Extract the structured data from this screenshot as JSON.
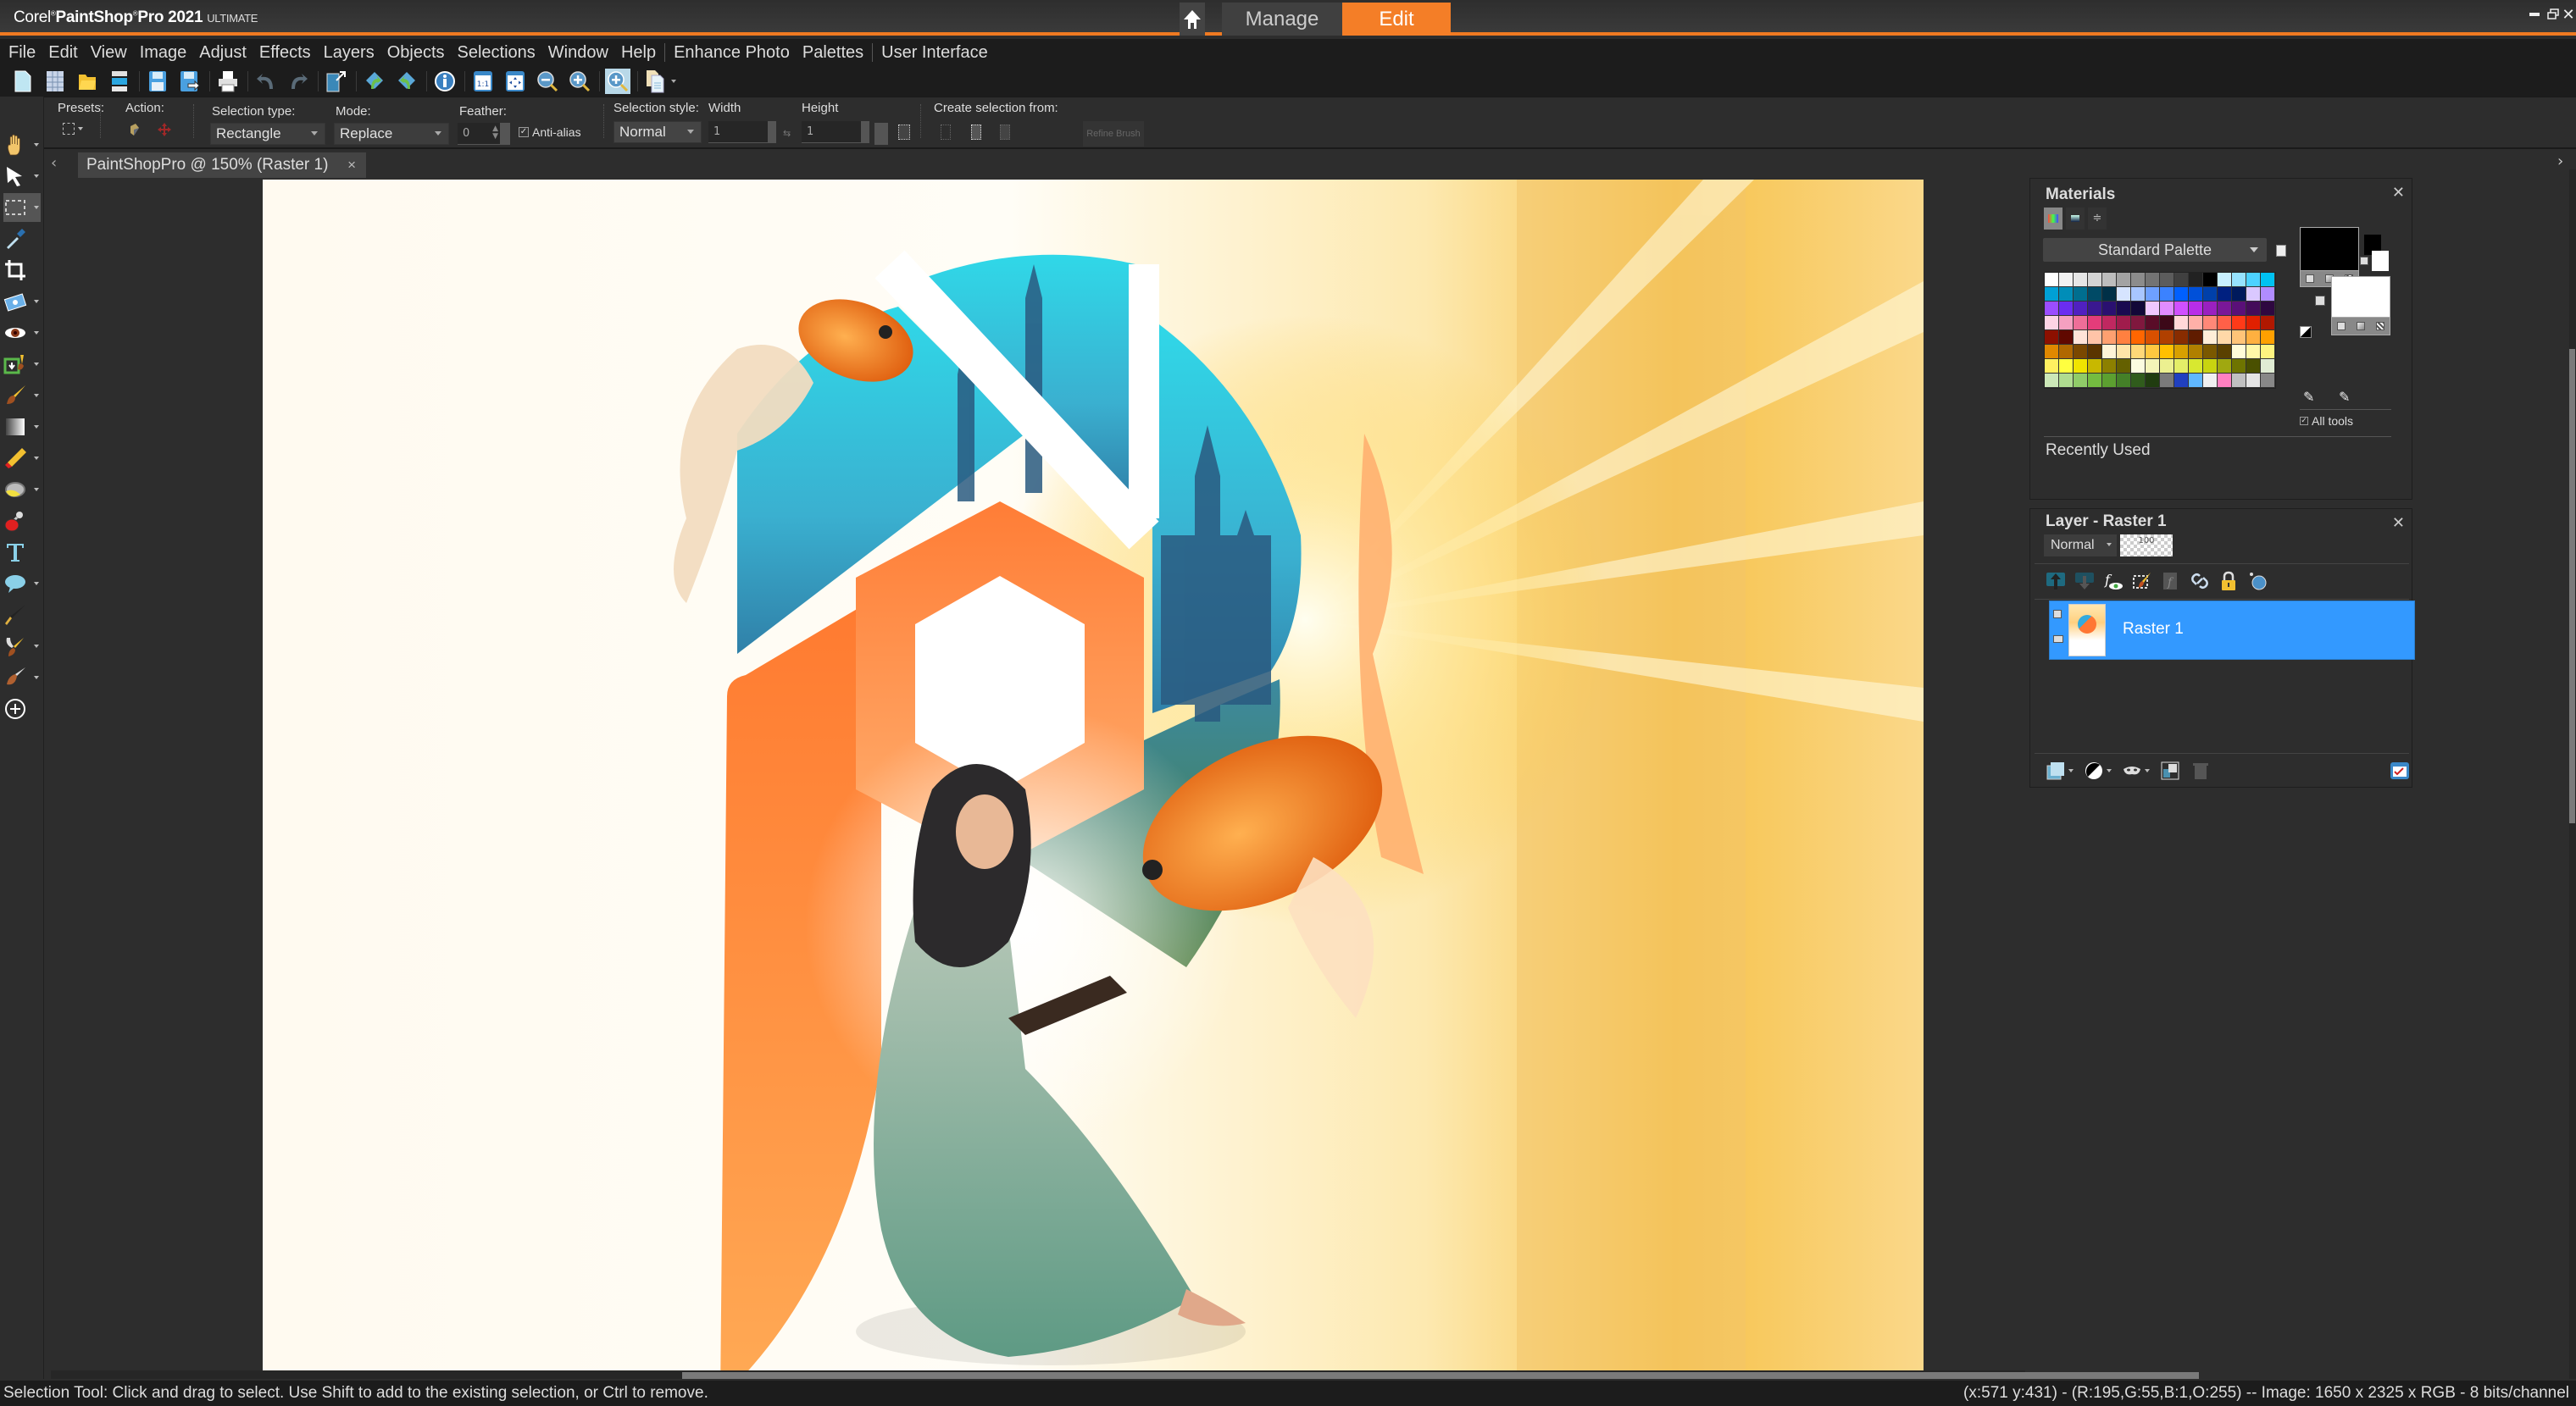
{
  "titlebar": {
    "app_brand": "Corel",
    "app_name": "PaintShop",
    "app_name2": "Pro",
    "app_version": "2021",
    "app_edition": "ULTIMATE",
    "workspaces": [
      {
        "label": "Manage",
        "active": false
      },
      {
        "label": "Edit",
        "active": true
      }
    ],
    "home_icon": "home-icon",
    "window_controls": [
      "minimize-icon",
      "restore-icon",
      "close-icon"
    ]
  },
  "menu": {
    "items": [
      "File",
      "Edit",
      "View",
      "Image",
      "Adjust",
      "Effects",
      "Layers",
      "Objects",
      "Selections",
      "Window",
      "Help",
      "Enhance Photo",
      "Palettes",
      "User Interface"
    ]
  },
  "toolbar": {
    "buttons": [
      "new-icon",
      "new-from-template-icon",
      "open-icon",
      "scan-icon",
      "save-icon",
      "save-as-icon",
      "print-icon",
      "undo-icon",
      "redo-icon",
      "resize-icon",
      "undo-history-icon",
      "redo-history-icon",
      "image-info-icon",
      "actual-size-icon",
      "fit-window-icon",
      "zoom-out-icon",
      "zoom-in-icon",
      "zoom-more-icon",
      "copy-icon"
    ]
  },
  "options": {
    "presets_label": "Presets:",
    "action_label": "Action:",
    "selection_type_label": "Selection type:",
    "selection_type_value": "Rectangle",
    "mode_label": "Mode:",
    "mode_value": "Replace",
    "feather_label": "Feather:",
    "feather_value": "0",
    "antialias_label": "Anti-alias",
    "antialias_checked": true,
    "selection_style_label": "Selection style:",
    "selection_style_value": "Normal",
    "width_label": "Width",
    "width_value": "1",
    "height_label": "Height",
    "height_value": "1",
    "create_from_label": "Create selection from:",
    "refine_brush_label": "Refine Brush"
  },
  "tools": [
    {
      "name": "pan-tool",
      "icon": "hand-icon",
      "dropdown": true
    },
    {
      "name": "pick-tool",
      "icon": "arrow-icon",
      "dropdown": true
    },
    {
      "name": "selection-tool",
      "icon": "marquee-icon",
      "dropdown": true,
      "active": true
    },
    {
      "name": "dropper-tool",
      "icon": "eyedropper-icon",
      "dropdown": false
    },
    {
      "name": "crop-tool",
      "icon": "crop-icon",
      "dropdown": false
    },
    {
      "name": "straighten-tool",
      "icon": "photo-icon",
      "dropdown": true
    },
    {
      "name": "red-eye-tool",
      "icon": "eye-icon",
      "dropdown": true
    },
    {
      "name": "clone-tool",
      "icon": "clone-icon",
      "dropdown": true
    },
    {
      "name": "paint-brush-tool",
      "icon": "brush-icon",
      "dropdown": true
    },
    {
      "name": "gradient-tool",
      "icon": "gradient-icon",
      "dropdown": true
    },
    {
      "name": "eraser-tool",
      "icon": "eraser-icon",
      "dropdown": true
    },
    {
      "name": "fill-tool",
      "icon": "paint-bucket-icon",
      "dropdown": true
    },
    {
      "name": "picture-tube-tool",
      "icon": "stamp-icon",
      "dropdown": false
    },
    {
      "name": "text-tool",
      "icon": "text-icon",
      "dropdown": false
    },
    {
      "name": "preset-shape-tool",
      "icon": "speech-bubble-icon",
      "dropdown": true
    },
    {
      "name": "pen-tool",
      "icon": "pen-icon",
      "dropdown": false
    },
    {
      "name": "warp-brush-tool",
      "icon": "warp-brush-icon",
      "dropdown": true
    },
    {
      "name": "smudge-tool",
      "icon": "smudge-icon",
      "dropdown": true
    },
    {
      "name": "add-tool",
      "icon": "plus-circle-icon",
      "dropdown": false
    }
  ],
  "document": {
    "tab_label": "PaintShopPro @ 150% (Raster 1)",
    "close_label": "×"
  },
  "materials": {
    "title": "Materials",
    "palette_select": "Standard Palette",
    "recently_used_label": "Recently Used",
    "all_tools_label": "All tools",
    "all_tools_checked": true,
    "foreground_color": "#000000",
    "background_color": "#ffffff",
    "swatches": [
      "#ffffff",
      "#f2f2f2",
      "#e6e6e6",
      "#d4d4d4",
      "#bdbdbd",
      "#a3a3a3",
      "#8c8c8c",
      "#737373",
      "#5c5c5c",
      "#404040",
      "#222222",
      "#000000",
      "#c8f0ff",
      "#96e3ff",
      "#4dd2ff",
      "#00c2f2",
      "#00a0d6",
      "#008db8",
      "#006e8f",
      "#004a66",
      "#003047",
      "#d6e4ff",
      "#a8c6ff",
      "#6ea0ff",
      "#3b82ff",
      "#0060ff",
      "#0050d9",
      "#0040aa",
      "#002080",
      "#001a5c",
      "#dac8ff",
      "#b08cff",
      "#9b4dff",
      "#6a2df0",
      "#5020c0",
      "#3a1890",
      "#2a1070",
      "#1a0a50",
      "#120838",
      "#f0c8ff",
      "#e08cff",
      "#d050ff",
      "#b82de8",
      "#9a20c0",
      "#7a1898",
      "#5a1078",
      "#440c5a",
      "#2e0840",
      "#fcd4e4",
      "#f5a0c0",
      "#ee6e98",
      "#e43c7a",
      "#c02860",
      "#a01c4c",
      "#80183e",
      "#5a0c28",
      "#3c0818",
      "#ffd8d8",
      "#ffb0a8",
      "#ff8878",
      "#ff6048",
      "#ff3a18",
      "#e02000",
      "#b01800",
      "#8c1000",
      "#600800",
      "#ffe4d8",
      "#ffc4a8",
      "#ffa070",
      "#ff8040",
      "#ff6600",
      "#d85000",
      "#b04000",
      "#882c00",
      "#601c00",
      "#ffeed8",
      "#ffd8a8",
      "#ffc478",
      "#ffb040",
      "#ffa000",
      "#e08800",
      "#b06800",
      "#7a4800",
      "#5a3400",
      "#fff4d8",
      "#ffe4a8",
      "#ffd878",
      "#ffc840",
      "#ffc000",
      "#d8a000",
      "#b08000",
      "#7a5800",
      "#5a4000",
      "#fffcd8",
      "#fff8a8",
      "#fff480",
      "#fff060",
      "#ffff40",
      "#f0e400",
      "#c8b800",
      "#8c8000",
      "#646000",
      "#fcfce0",
      "#f4f4b8",
      "#ecf090",
      "#e4ee68",
      "#d8e830",
      "#c8d410",
      "#a0a810",
      "#6e7400",
      "#4a5000",
      "#e0ecd4",
      "#cce8b8",
      "#b0dc90",
      "#90cc68",
      "#74bc40",
      "#5ca030",
      "#448028",
      "#305c1c",
      "#203c10",
      "#7a7a7a",
      "#2040c0",
      "#60b8ff",
      "#f0f0f0",
      "#ff80c0",
      "#c0c0c0",
      "#e4e4e4",
      "#888888"
    ]
  },
  "layers": {
    "title": "Layer - Raster 1",
    "blend_mode": "Normal",
    "opacity": "100",
    "toolbar_icons": [
      "move-layer-up-icon",
      "move-layer-down-icon",
      "layer-visibility-fx-icon",
      "edit-selection-icon",
      "mask-fx-icon",
      "link-icon",
      "lock-icon",
      "layer-style-icon"
    ],
    "items": [
      {
        "name": "Raster 1",
        "selected": true
      }
    ],
    "bottom_icons": [
      "new-layer-icon",
      "adjustment-layer-icon",
      "mask-icon",
      "merge-icon",
      "delete-layer-icon",
      "layer-properties-icon"
    ],
    "selected_color": "#3399ff"
  },
  "status": {
    "hint": "Selection Tool: Click and drag to select. Use Shift to add to the existing selection, or Ctrl to remove.",
    "info": "(x:571 y:431) - (R:195,G:55,B:1,O:255) -- Image:  1650 x 2325 x RGB - 8 bits/channel"
  },
  "colors": {
    "accent": "#f47e27",
    "selection": "#3399ff",
    "logo_orange": "#ff7a30",
    "logo_cyan": "#2ed3e6"
  }
}
